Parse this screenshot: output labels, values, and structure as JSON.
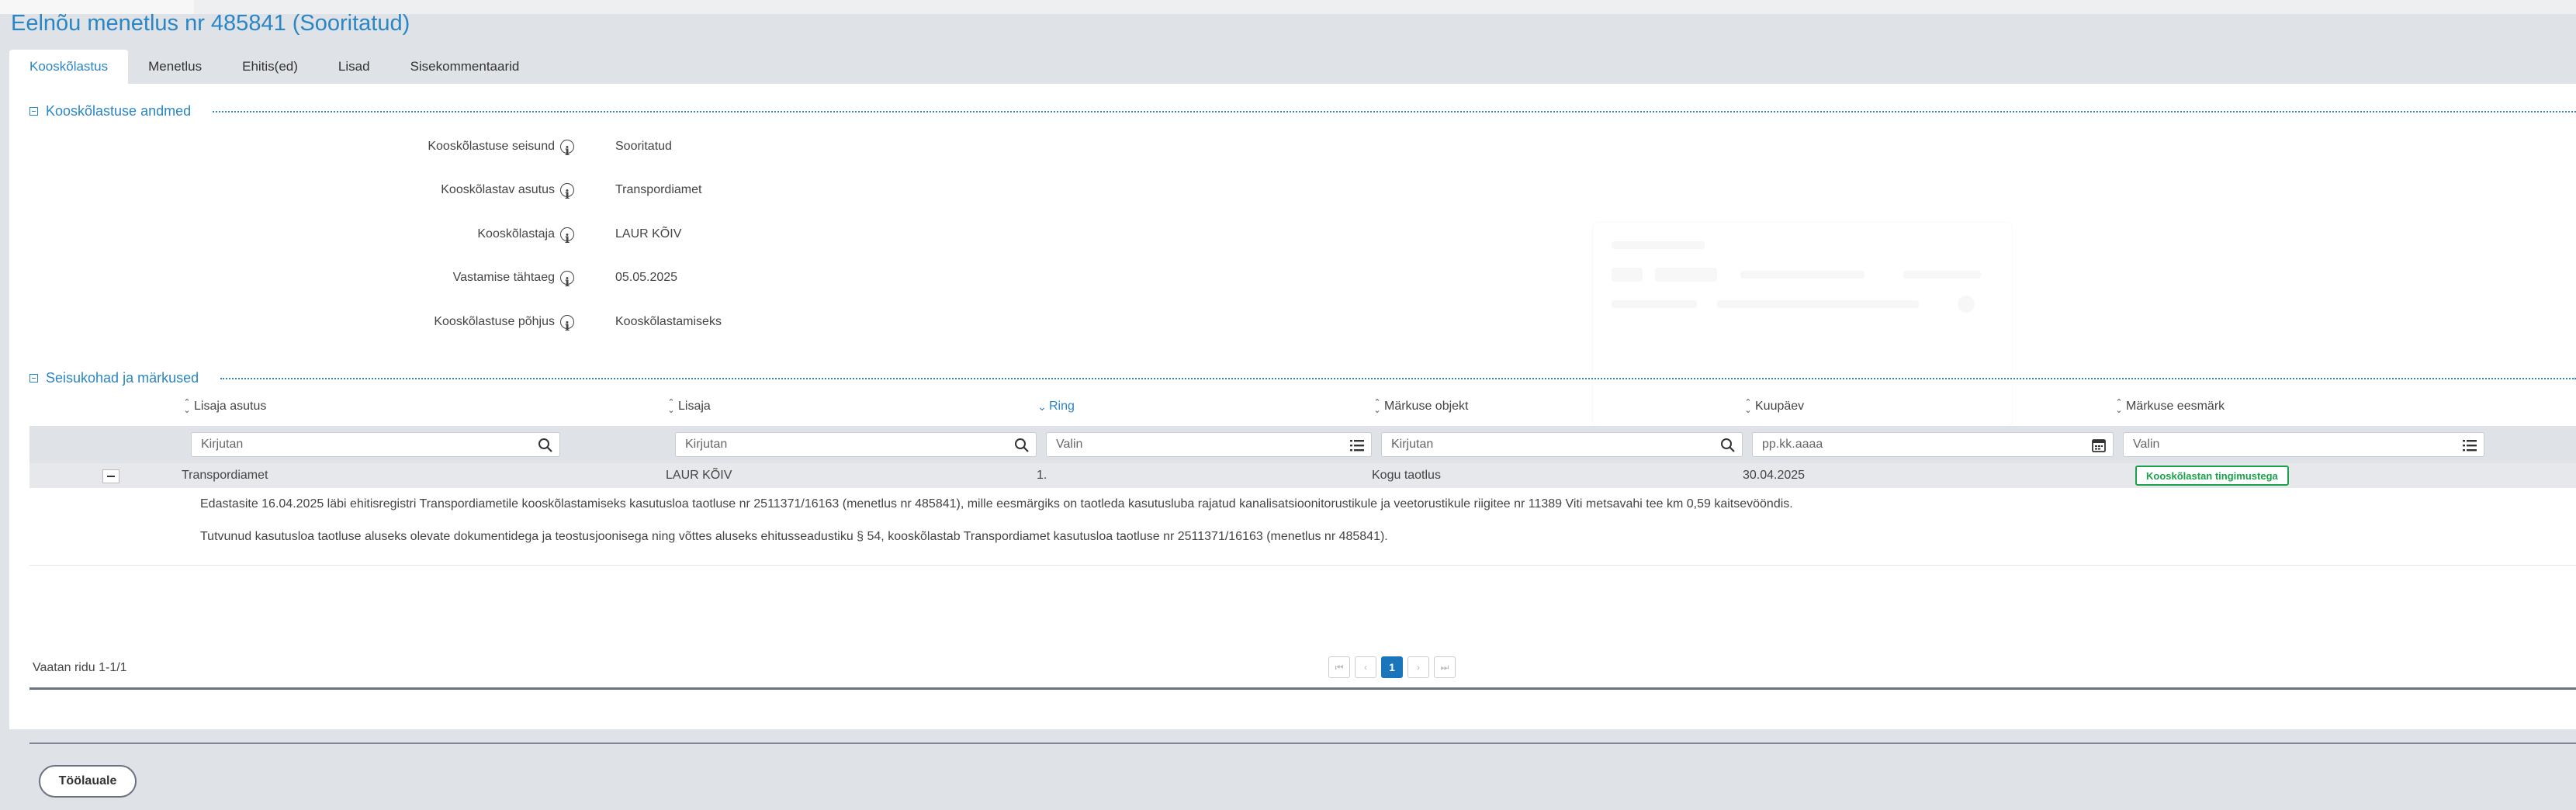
{
  "page": {
    "title": "Eelnõu menetlus nr 485841 (Sooritatud)"
  },
  "tabs": [
    {
      "label": "Kooskõlastus",
      "active": true
    },
    {
      "label": "Menetlus"
    },
    {
      "label": "Ehitis(ed)"
    },
    {
      "label": "Lisad"
    },
    {
      "label": "Sisekommentaarid"
    }
  ],
  "approval": {
    "section_title": "Kooskõlastuse andmed",
    "fields": [
      {
        "label": "Kooskõlastuse seisund",
        "value": "Sooritatud"
      },
      {
        "label": "Kooskõlastav asutus",
        "value": "Transpordiamet"
      },
      {
        "label": "Kooskõlastaja",
        "value": "LAUR KÕIV"
      },
      {
        "label": "Vastamise tähtaeg",
        "value": "05.05.2025"
      },
      {
        "label": "Kooskõlastuse põhjus",
        "value": "Kooskõlastamiseks"
      }
    ]
  },
  "remarks": {
    "section_title": "Seisukohad ja märkused",
    "columns": [
      {
        "label": "Lisaja asutus",
        "sort": "unsorted"
      },
      {
        "label": "Lisaja",
        "sort": "unsorted"
      },
      {
        "label": "Ring",
        "sort": "descending"
      },
      {
        "label": "Märkuse objekt",
        "sort": "unsorted"
      },
      {
        "label": "Kuupäev",
        "sort": "unsorted"
      },
      {
        "label": "Märkuse eesmärk",
        "sort": "unsorted"
      }
    ],
    "filters": [
      {
        "placeholder": "Kirjutan",
        "icon": "search-icon"
      },
      {
        "placeholder": "Kirjutan",
        "icon": "search-icon"
      },
      {
        "placeholder": "Valin",
        "icon": "list-icon"
      },
      {
        "placeholder": "Kirjutan",
        "icon": "search-icon"
      },
      {
        "placeholder": "pp.kk.aaaa",
        "icon": "calendar-icon"
      },
      {
        "placeholder": "Valin",
        "icon": "list-icon"
      }
    ],
    "rows": [
      {
        "cells": [
          "Transpordiamet",
          "LAUR KÕIV",
          "1.",
          "Kogu taotlus",
          "30.04.2025"
        ],
        "purpose": "Kooskõlastan tingimustega",
        "details": [
          "Edastasite 16.04.2025 läbi ehitisregistri Transpordiametile kooskõlastamiseks kasutusloa taotluse nr 2511371/16163 (menetlus nr 485841), mille eesmärgiks on taotleda kasutusluba rajatud kanalisatsioonitorustikule ja veetorustikule riigitee nr 11389 Viti metsavahi tee km 0,59 kaitsevööndis.",
          "Tutvunud kasutusloa taotluse aluseks olevate dokumentidega ja teostusjoonisega ning võttes aluseks ehitusseadustiku § 54, kooskõlastab Transpordiamet kasutusloa taotluse nr 2511371/16163 (menetlus nr 485841)."
        ]
      }
    ],
    "pager_text": "Vaatan ridu 1-1/1",
    "current_page": "1"
  },
  "back_button": "Töölauale",
  "colors": {
    "accent": "#2a86c4",
    "success": "#18a34a",
    "pager_active": "#1b75bb"
  }
}
